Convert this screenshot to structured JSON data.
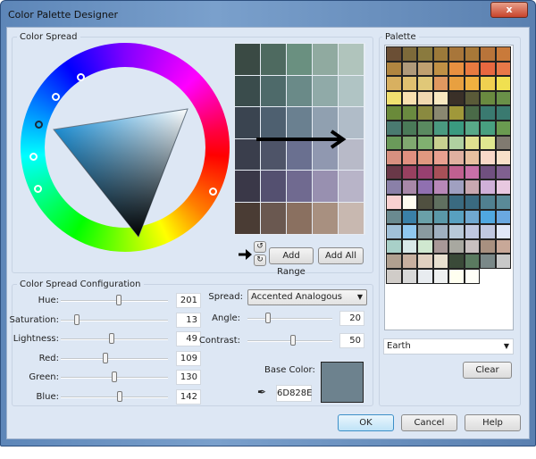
{
  "window": {
    "title": "Color Palette Designer",
    "close_label": "x"
  },
  "color_spread": {
    "label": "Color Spread",
    "grid": [
      [
        "#3a4a44",
        "#4e6a60",
        "#6a9080",
        "#90aaa0",
        "#b0c4bc"
      ],
      [
        "#3a4c4c",
        "#4e6a6a",
        "#6a8a88",
        "#90aaa8",
        "#b0c4c4"
      ],
      [
        "#3a4450",
        "#4e6070",
        "#6a8090",
        "#90a0b0",
        "#b0bcc8"
      ],
      [
        "#3a3e4c",
        "#4e5468",
        "#6a7090",
        "#9098b0",
        "#b8bac8"
      ],
      [
        "#3a3848",
        "#545070",
        "#706a90",
        "#9890b0",
        "#b8b4c8"
      ],
      [
        "#4a3c34",
        "#6a5850",
        "#8a7060",
        "#a89080",
        "#c8b8b0"
      ]
    ],
    "add_range_label": "Add Range",
    "add_all_label": "Add All"
  },
  "palette": {
    "label": "Palette",
    "selected": "Earth",
    "clear_label": "Clear",
    "rows": [
      [
        "#6b4f35",
        "#7d6a3a",
        "#8a7a3e",
        "#9c7a3a",
        "#a8763a",
        "#a87838",
        "#b8743a",
        "#c97a3a"
      ],
      [
        "#b08540",
        "#b09a7a",
        "#c0a070",
        "#c09045",
        "#e89040",
        "#e87a40",
        "#e86840",
        "#e87848"
      ],
      [
        "#d8b060",
        "#e0c070",
        "#e0c878",
        "#e09860",
        "#e8a040",
        "#f0b040",
        "#f0d050",
        "#f0e050"
      ],
      [
        "#f0e070",
        "#f8e0b0",
        "#f0d8b0",
        "#f8e8c0",
        "#3a3028",
        "#5a5a38",
        "#6a8a40",
        "#6a9048"
      ],
      [
        "#6a8a3a",
        "#6a8a40",
        "#8a8a40",
        "#8a8870",
        "#a0983a",
        "#4a6a48",
        "#3a7a70",
        "#3a7a70"
      ],
      [
        "#4a7a70",
        "#4a7a58",
        "#5a8a60",
        "#4a9a80",
        "#3a9a80",
        "#58a888",
        "#48a080",
        "#6a9a50"
      ],
      [
        "#6a9a5a",
        "#80a870",
        "#80b070",
        "#c8d090",
        "#b0d0a0",
        "#e0e090",
        "#e0e890",
        "#807a70"
      ],
      [
        "#d89080",
        "#e09080",
        "#e09880",
        "#e8a090",
        "#e0b0a0",
        "#e8c0a0",
        "#f8d8c8",
        "#f8e0c8"
      ],
      [
        "#6a3848",
        "#984060",
        "#984070",
        "#a85058",
        "#c06090",
        "#c870a8",
        "#705080",
        "#806090"
      ],
      [
        "#8a80a8",
        "#a888a8",
        "#9070b0",
        "#b888b8",
        "#a0a0c0",
        "#c8a8b0",
        "#d0b0d8",
        "#e8c8e0"
      ],
      [
        "#f8d0d0",
        "#fffcf0",
        "#505040",
        "#607060",
        "#3a6a80",
        "#3a6a80",
        "#508090",
        "#5a8a98"
      ],
      [
        "#6a8a90",
        "#3a80a8",
        "#6aa0a8",
        "#5a98a8",
        "#58a0c0",
        "#70a8d0",
        "#50a8e0",
        "#6aa8e0"
      ],
      [
        "#a0c0d8",
        "#90c8f0",
        "#8a9aa0",
        "#a0b0c0",
        "#b8c8d8",
        "#c0c8e0",
        "#c0c8e0",
        "#e0e8f8"
      ],
      [
        "#a8d0c8",
        "#d8e8e8",
        "#d0e8d0",
        "#a89898",
        "#a8a8a0",
        "#c8c0c0",
        "#a89080",
        "#c8a898"
      ],
      [
        "#b0a090",
        "#c8b0a0",
        "#e0d0c0",
        "#e8e0d0",
        "#3a4a38",
        "#5a7a60",
        "#7a8888",
        "#c8c8c8"
      ],
      [
        "#d0ccc8",
        "#d8d8d8",
        "#e8ecf0",
        "#eef0f0",
        "#fffff0",
        "#fffff8"
      ]
    ]
  },
  "config": {
    "label": "Color Spread Configuration",
    "sliders": [
      {
        "label": "Hue:",
        "value": "201",
        "fraction": 0.54
      },
      {
        "label": "Saturation:",
        "value": "13",
        "fraction": 0.13
      },
      {
        "label": "Lightness:",
        "value": "49",
        "fraction": 0.47
      },
      {
        "label": "Red:",
        "value": "109",
        "fraction": 0.41
      },
      {
        "label": "Green:",
        "value": "130",
        "fraction": 0.5
      },
      {
        "label": "Blue:",
        "value": "142",
        "fraction": 0.55
      }
    ],
    "spread_label": "Spread:",
    "spread_value": "Accented Analogous",
    "angle_label": "Angle:",
    "angle_value": "20",
    "angle_fraction": 0.22,
    "contrast_label": "Contrast:",
    "contrast_value": "50",
    "contrast_fraction": 0.5,
    "base_color_label": "Base Color:",
    "base_color_hex": "6D828E",
    "base_color": "#6d828e"
  },
  "buttons": {
    "ok": "OK",
    "cancel": "Cancel",
    "help": "Help"
  }
}
